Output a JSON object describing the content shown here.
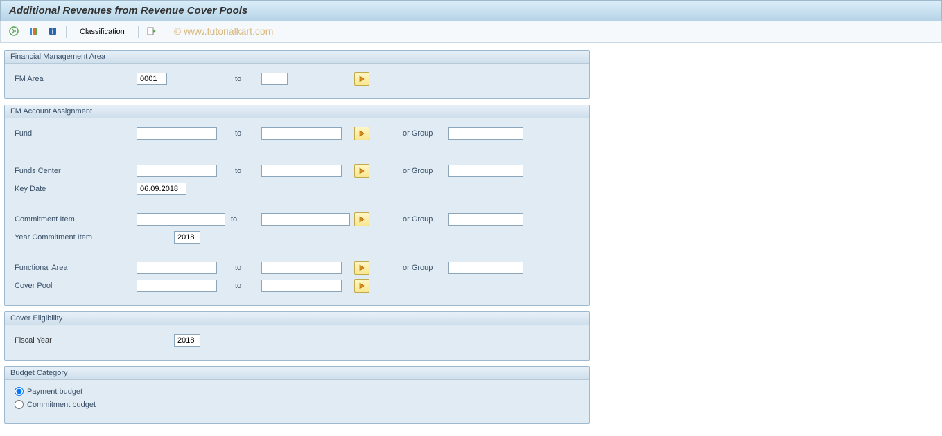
{
  "title": "Additional Revenues from Revenue Cover Pools",
  "watermark": "© www.tutorialkart.com",
  "toolbar": {
    "classification_label": "Classification"
  },
  "groups": {
    "fma": {
      "title": "Financial Management Area",
      "rows": {
        "fm_area": {
          "label": "FM Area",
          "value": "0001",
          "to_label": "to",
          "to_value": ""
        }
      }
    },
    "acct": {
      "title": "FM Account Assignment",
      "rows": {
        "fund": {
          "label": "Fund",
          "value": "",
          "to_label": "to",
          "to_value": "",
          "or_label": "or Group",
          "or_value": ""
        },
        "funds_center": {
          "label": "Funds Center",
          "value": "",
          "to_label": "to",
          "to_value": "",
          "or_label": "or Group",
          "or_value": ""
        },
        "key_date": {
          "label": "Key Date",
          "value": "06.09.2018"
        },
        "commitment_item": {
          "label": "Commitment Item",
          "value": "",
          "to_label": "to",
          "to_value": "",
          "or_label": "or Group",
          "or_value": ""
        },
        "year_ci": {
          "label": "Year Commitment Item",
          "value": "2018"
        },
        "functional_area": {
          "label": "Functional Area",
          "value": "",
          "to_label": "to",
          "to_value": "",
          "or_label": "or Group",
          "or_value": ""
        },
        "cover_pool": {
          "label": "Cover Pool",
          "value": "",
          "to_label": "to",
          "to_value": ""
        }
      }
    },
    "cover": {
      "title": "Cover Eligibility",
      "rows": {
        "fiscal_year": {
          "label": "Fiscal Year",
          "value": "2018"
        }
      }
    },
    "budget": {
      "title": "Budget Category",
      "options": {
        "payment": {
          "label": "Payment budget",
          "checked": true
        },
        "commitment": {
          "label": "Commitment budget",
          "checked": false
        }
      }
    }
  }
}
